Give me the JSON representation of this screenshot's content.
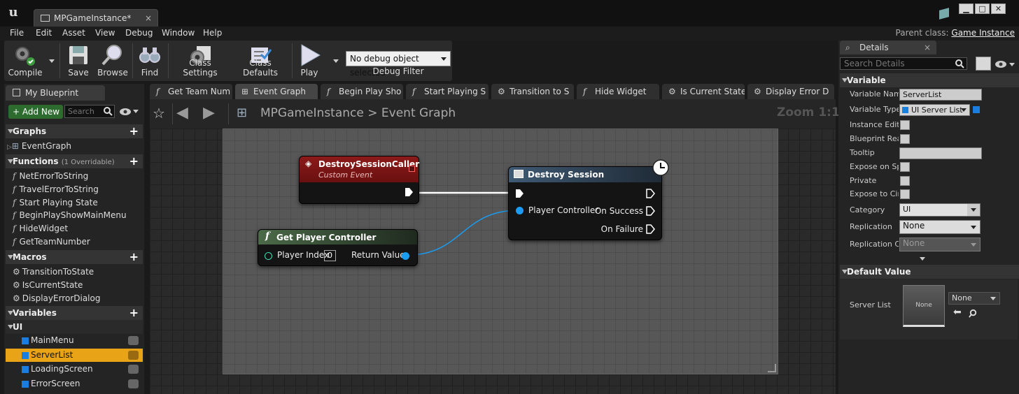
{
  "window": {
    "doc_tab": "MPGameInstance*",
    "close_glyph": "×",
    "min_glyph": "▁",
    "max_glyph": "□",
    "close_btn_glyph": "✕"
  },
  "menu": [
    "File",
    "Edit",
    "Asset",
    "View",
    "Debug",
    "Window",
    "Help"
  ],
  "parent_class": {
    "label": "Parent class:",
    "value": "Game Instance"
  },
  "toolbar": {
    "compile": "Compile",
    "save": "Save",
    "browse": "Browse",
    "find": "Find",
    "class_settings": "Class Settings",
    "class_defaults": "Class Defaults",
    "play": "Play",
    "debug_object": "No debug object selected",
    "debug_filter": "Debug Filter"
  },
  "my_blueprint": {
    "tab": "My Blueprint",
    "add_new": "+ Add New",
    "search_placeholder": "Search",
    "graphs_header": "Graphs",
    "graphs": [
      "EventGraph"
    ],
    "functions_header": "Functions",
    "functions_note": "(1 Overridable)",
    "functions": [
      "NetErrorToString",
      "TravelErrorToString",
      "Start Playing State",
      "BeginPlayShowMainMenu",
      "HideWidget",
      "GetTeamNumber"
    ],
    "macros_header": "Macros",
    "macros": [
      "TransitionToState",
      "IsCurrentState",
      "DisplayErrorDialog"
    ],
    "variables_header": "Variables",
    "var_category": "UI",
    "variables": [
      "MainMenu",
      "ServerList",
      "LoadingScreen",
      "ErrorScreen"
    ],
    "selected_variable": "ServerList"
  },
  "graph_tabs": [
    "Get Team Num",
    "Event Graph",
    "Begin Play Sho",
    "Start Playing S",
    "Transition to S",
    "Hide Widget",
    "Is Current State",
    "Display Error D"
  ],
  "graph_tab_icons": [
    "f",
    "⊞",
    "f",
    "f",
    "⚙",
    "f",
    "⚙",
    "⚙"
  ],
  "breadcrumb": {
    "root": "MPGameInstance",
    "sep": ">",
    "current": "Event Graph"
  },
  "zoom": "Zoom 1:1",
  "nodes": {
    "custom_event": {
      "title": "DestroySessionCaller",
      "subtitle": "Custom Event"
    },
    "destroy_session": {
      "title": "Destroy Session",
      "pin_in": "Player Controller",
      "on_success": "On Success",
      "on_failure": "On Failure"
    },
    "get_player_controller": {
      "title": "Get Player Controller",
      "player_index_label": "Player Index",
      "player_index_value": "0",
      "return_value": "Return Value"
    }
  },
  "details": {
    "tab": "Details",
    "search_placeholder": "Search Details",
    "variable_header": "Variable",
    "variable_name_label": "Variable Name",
    "variable_name": "ServerList",
    "variable_type_label": "Variable Type",
    "variable_type": "UI Server List",
    "instance_editable_label": "Instance Editable",
    "blueprint_readonly_label": "Blueprint Read Only",
    "tooltip_label": "Tooltip",
    "tooltip_value": "",
    "expose_spawn_label": "Expose on Spawn",
    "private_label": "Private",
    "expose_cinematics_label": "Expose to Cinematics",
    "category_label": "Category",
    "category_value": "UI",
    "replication_label": "Replication",
    "replication_value": "None",
    "replication_cond_label": "Replication Condition",
    "replication_cond_value": "None",
    "default_value_header": "Default Value",
    "server_list_label": "Server List",
    "thumb_label": "None",
    "asset_value": "None"
  },
  "colors": {
    "accent_orange": "#e8a317",
    "pin_blue": "#1a9cf0",
    "event_red": "#8c1a1a",
    "function_green": "#3a5a3a",
    "var_blue": "#1a7ee0"
  }
}
